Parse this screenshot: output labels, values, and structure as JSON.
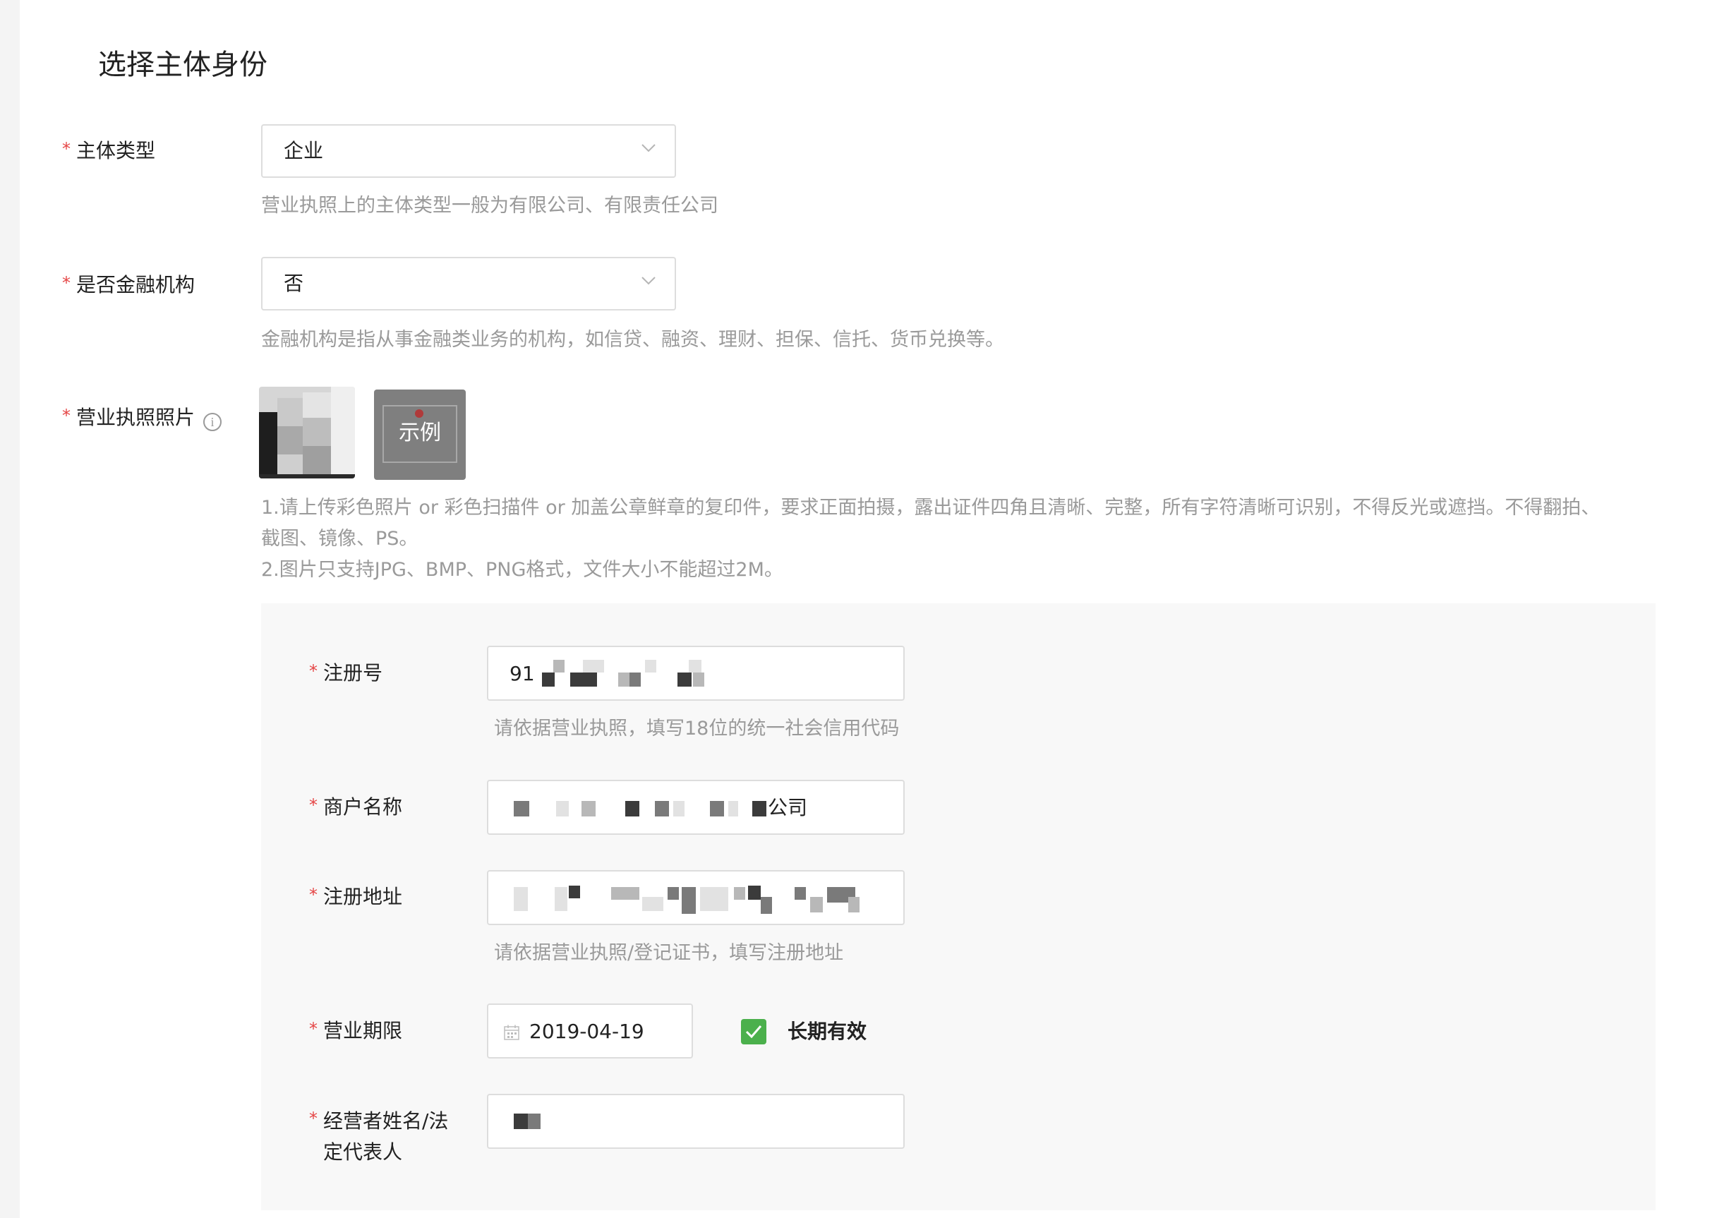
{
  "section_title": "选择主体身份",
  "entity_type": {
    "label": "主体类型",
    "value": "企业",
    "hint": "营业执照上的主体类型一般为有限公司、有限责任公司"
  },
  "financial_institution": {
    "label": "是否金融机构",
    "value": "否",
    "hint": "金融机构是指从事金融类业务的机构，如信贷、融资、理财、担保、信托、货币兑换等。"
  },
  "license_photo": {
    "label": "营业执照照片",
    "info_icon": "i",
    "sample_label": "示例",
    "hint_line1": "1.请上传彩色照片 or 彩色扫描件 or 加盖公章鲜章的复印件，要求正面拍摄，露出证件四角且清晰、完整，所有字符清晰可识别，不得反光或遮挡。不得翻拍、截图、镜像、PS。",
    "hint_line2": "2.图片只支持JPG、BMP、PNG格式，文件大小不能超过2M。"
  },
  "form": {
    "reg_number": {
      "label": "注册号",
      "value_prefix": "91",
      "hint": "请依据营业执照，填写18位的统一社会信用代码"
    },
    "merchant_name": {
      "label": "商户名称",
      "value_suffix": "公司"
    },
    "reg_address": {
      "label": "注册地址",
      "hint": "请依据营业执照/登记证书，填写注册地址"
    },
    "business_term": {
      "label": "营业期限",
      "start_date": "2019-04-19",
      "long_term_label": "长期有效",
      "long_term_checked": true
    },
    "legal_rep": {
      "label": "经营者姓名/法定代表人"
    }
  },
  "colors": {
    "required_star": "#e54545",
    "checkbox_green": "#4bb04c",
    "hint_gray": "#9a9a9a"
  },
  "icons": {
    "select_arrow": "chevron-down-icon",
    "info": "info-icon",
    "calendar": "calendar-icon",
    "check": "check-icon"
  }
}
